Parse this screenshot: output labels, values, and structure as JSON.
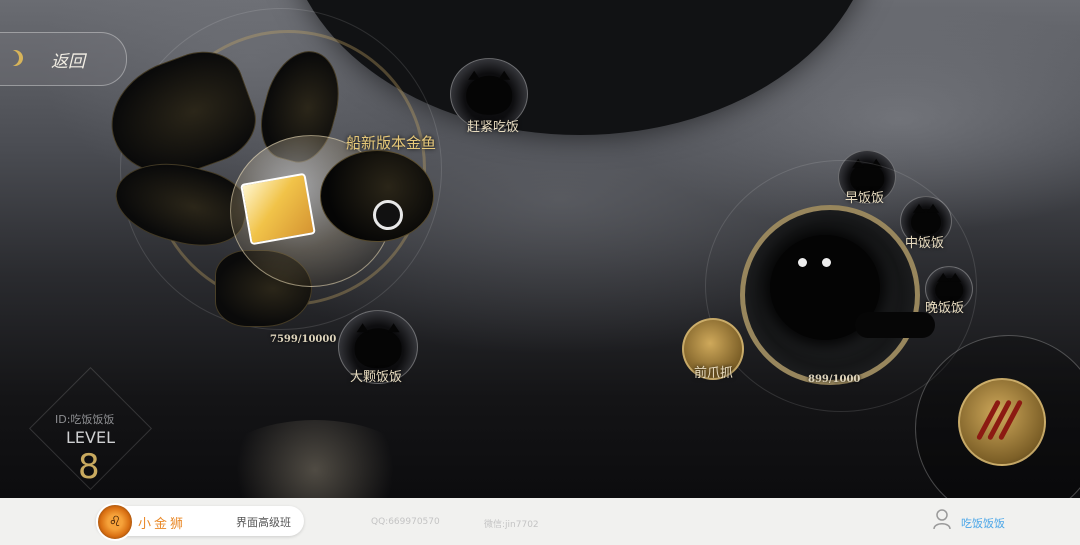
{
  "back": {
    "label": "返回"
  },
  "goldfish": {
    "title": "船新版本金鱼",
    "progress": "7599/10000"
  },
  "bubbles": {
    "top": "赶紧吃饭",
    "bottom_left": "大颗饭饭",
    "breakfast": "早饭饭",
    "lunch": "中饭饭",
    "dinner": "晚饭饭",
    "front_claw": "前爪抓"
  },
  "big_cat": {
    "progress": "899/1000"
  },
  "level": {
    "id_text": "ID:吃饭饭饭",
    "word": "LEVEL",
    "number": "8"
  },
  "footer": {
    "brand_name": "小金狮",
    "course": "界面高级班",
    "qq": "QQ:669970570",
    "wechat": "微信:jin7702",
    "user_name": "吃饭饭饭",
    "brand_color": "#e98a2a",
    "user_color": "#4aa6e8"
  }
}
